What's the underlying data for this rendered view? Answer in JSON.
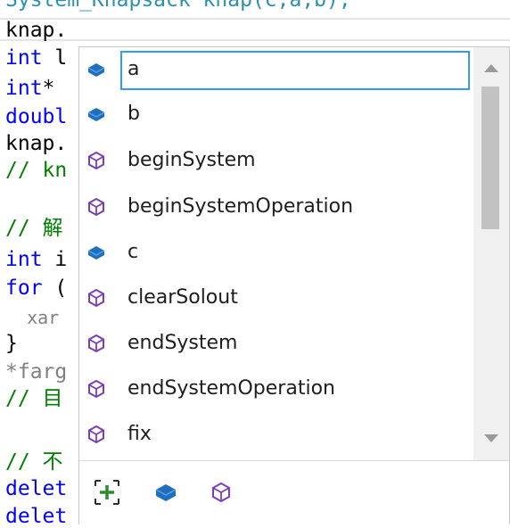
{
  "code": {
    "lines": [
      {
        "top_text": "System_Knapsack knap(c,a,b);"
      },
      {
        "text": "knap."
      },
      {
        "a": "int",
        "b": " l"
      },
      {
        "a": "int",
        "b": "*"
      },
      {
        "a": "doubl",
        "b": ""
      },
      {
        "text": "knap."
      },
      {
        "text": "// kn"
      },
      {
        "text": ""
      },
      {
        "text": "// 解"
      },
      {
        "a": "int",
        "b": " i"
      },
      {
        "a": "for",
        "b": " ("
      },
      {
        "text": "  xar"
      },
      {
        "text": "}"
      },
      {
        "text": "*farg"
      },
      {
        "text": "// 目"
      },
      {
        "text": ""
      },
      {
        "text": "// 不"
      },
      {
        "a": "delet",
        "b": ""
      },
      {
        "a": "delet",
        "b": ""
      }
    ]
  },
  "completion": {
    "items": [
      {
        "label": "a",
        "icon": "field-icon",
        "color": "#1f6fbf"
      },
      {
        "label": "b",
        "icon": "field-icon",
        "color": "#1f6fbf"
      },
      {
        "label": "beginSystem",
        "icon": "method-icon",
        "color": "#7a3fb8"
      },
      {
        "label": "beginSystemOperation",
        "icon": "method-icon",
        "color": "#7a3fb8"
      },
      {
        "label": "c",
        "icon": "field-icon",
        "color": "#1f6fbf"
      },
      {
        "label": "clearSolout",
        "icon": "method-icon",
        "color": "#7a3fb8"
      },
      {
        "label": "endSystem",
        "icon": "method-icon",
        "color": "#7a3fb8"
      },
      {
        "label": "endSystemOperation",
        "icon": "method-icon",
        "color": "#7a3fb8"
      },
      {
        "label": "fix",
        "icon": "method-icon",
        "color": "#7a3fb8"
      }
    ],
    "selected_index": 0,
    "filters": [
      {
        "name": "expand-filter-icon",
        "color": "#2e8b2e"
      },
      {
        "name": "field-filter-icon",
        "color": "#1f6fbf"
      },
      {
        "name": "method-filter-icon",
        "color": "#7a3fb8"
      }
    ]
  }
}
